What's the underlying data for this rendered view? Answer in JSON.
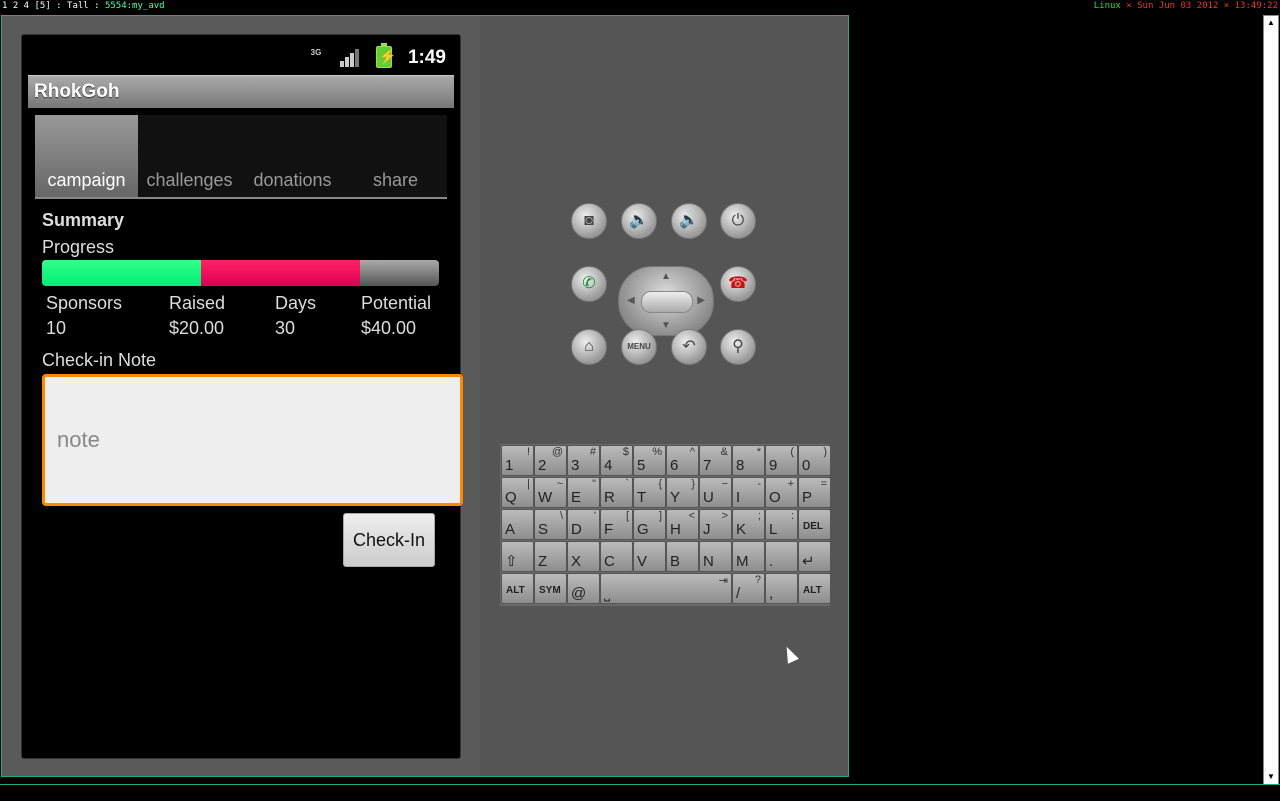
{
  "topbar": {
    "workspaces": "1 2 4 [5] : Tall :",
    "window_title": "5554:my_avd",
    "os": "Linux",
    "separator": "×",
    "datetime": "Sun Jun 03 2012 × 13:49:22"
  },
  "statusbar": {
    "network": "3G",
    "time": "1:49"
  },
  "app": {
    "title": "RhokGoh",
    "tabs": [
      {
        "label": "campaign",
        "active": true
      },
      {
        "label": "challenges",
        "active": false
      },
      {
        "label": "donations",
        "active": false
      },
      {
        "label": "share",
        "active": false
      }
    ],
    "summary_heading": "Summary",
    "progress_label": "Progress",
    "progress": {
      "raised_fraction": 0.4,
      "pledged_fraction": 0.8,
      "colors": {
        "raised": "#00ee77",
        "pledged": "#ee1155"
      }
    },
    "stats": [
      {
        "label": "Sponsors",
        "value": "10"
      },
      {
        "label": "Raised",
        "value": "$20.00"
      },
      {
        "label": "Days",
        "value": "30"
      },
      {
        "label": "Potential",
        "value": "$40.00"
      }
    ],
    "note_label": "Check-in Note",
    "note_placeholder": "note",
    "note_value": "",
    "checkin_button": "Check-In"
  },
  "controls": {
    "camera": "camera-icon",
    "volume_down": "volume-down-icon",
    "volume_up": "volume-up-icon",
    "power": "power-icon",
    "call": "call-icon",
    "end_call": "end-call-icon",
    "home": "home-icon",
    "menu": "MENU",
    "back": "back-icon",
    "search": "search-icon"
  },
  "keyboard": {
    "rows": [
      [
        [
          "1",
          "!"
        ],
        [
          "2",
          "@"
        ],
        [
          "3",
          "#"
        ],
        [
          "4",
          "$"
        ],
        [
          "5",
          "%"
        ],
        [
          "6",
          "^"
        ],
        [
          "7",
          "&"
        ],
        [
          "8",
          "*"
        ],
        [
          "9",
          "("
        ],
        [
          "0",
          ")"
        ]
      ],
      [
        [
          "Q",
          "|"
        ],
        [
          "W",
          "~"
        ],
        [
          "E",
          "\""
        ],
        [
          "R",
          "`"
        ],
        [
          "T",
          "{"
        ],
        [
          "Y",
          "}"
        ],
        [
          "U",
          "−"
        ],
        [
          "I",
          "-"
        ],
        [
          "O",
          "+"
        ],
        [
          "P",
          "="
        ]
      ],
      [
        [
          "A",
          ""
        ],
        [
          "S",
          "\\"
        ],
        [
          "D",
          "'"
        ],
        [
          "F",
          "["
        ],
        [
          "G",
          "]"
        ],
        [
          "H",
          "<"
        ],
        [
          "J",
          ">"
        ],
        [
          "K",
          ";"
        ],
        [
          "L",
          ":"
        ],
        [
          "DEL",
          ""
        ]
      ],
      [
        [
          "⇧",
          ""
        ],
        [
          "Z",
          ""
        ],
        [
          "X",
          ""
        ],
        [
          "C",
          ""
        ],
        [
          "V",
          ""
        ],
        [
          "B",
          ""
        ],
        [
          "N",
          ""
        ],
        [
          "M",
          ""
        ],
        [
          ".",
          ""
        ],
        [
          "↵",
          ""
        ]
      ]
    ],
    "bottom": {
      "alt_left": "ALT",
      "sym": "SYM",
      "at": "@",
      "space": "⎵",
      "tab": "⇥",
      "slash": "/",
      "question": "?",
      "comma": ",",
      "alt_right": "ALT"
    }
  }
}
